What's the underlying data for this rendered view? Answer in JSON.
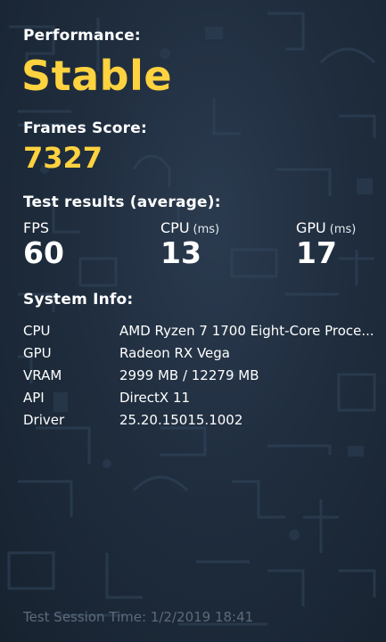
{
  "performance": {
    "label": "Performance:",
    "value": "Stable"
  },
  "frames_score": {
    "label": "Frames Score:",
    "value": "7327"
  },
  "test_results": {
    "label": "Test results (average):",
    "metrics": [
      {
        "label": "FPS",
        "unit": "",
        "value": "60"
      },
      {
        "label": "CPU",
        "unit": "(ms)",
        "value": "13"
      },
      {
        "label": "GPU",
        "unit": "(ms)",
        "value": "17"
      }
    ]
  },
  "system_info": {
    "label": "System Info:",
    "rows": [
      {
        "key": "CPU",
        "value": "AMD Ryzen 7 1700 Eight-Core Proce..."
      },
      {
        "key": "GPU",
        "value": "Radeon RX Vega"
      },
      {
        "key": "VRAM",
        "value": "2999 MB / 12279 MB"
      },
      {
        "key": "API",
        "value": "DirectX 11"
      },
      {
        "key": "Driver",
        "value": "25.20.15015.1002"
      }
    ]
  },
  "footer": {
    "session_time": "Test Session Time: 1/2/2019 18:41"
  },
  "colors": {
    "accent": "#ffd23f",
    "background": "#1f2d3e",
    "text": "#ffffff",
    "muted": "#5d6a79"
  }
}
